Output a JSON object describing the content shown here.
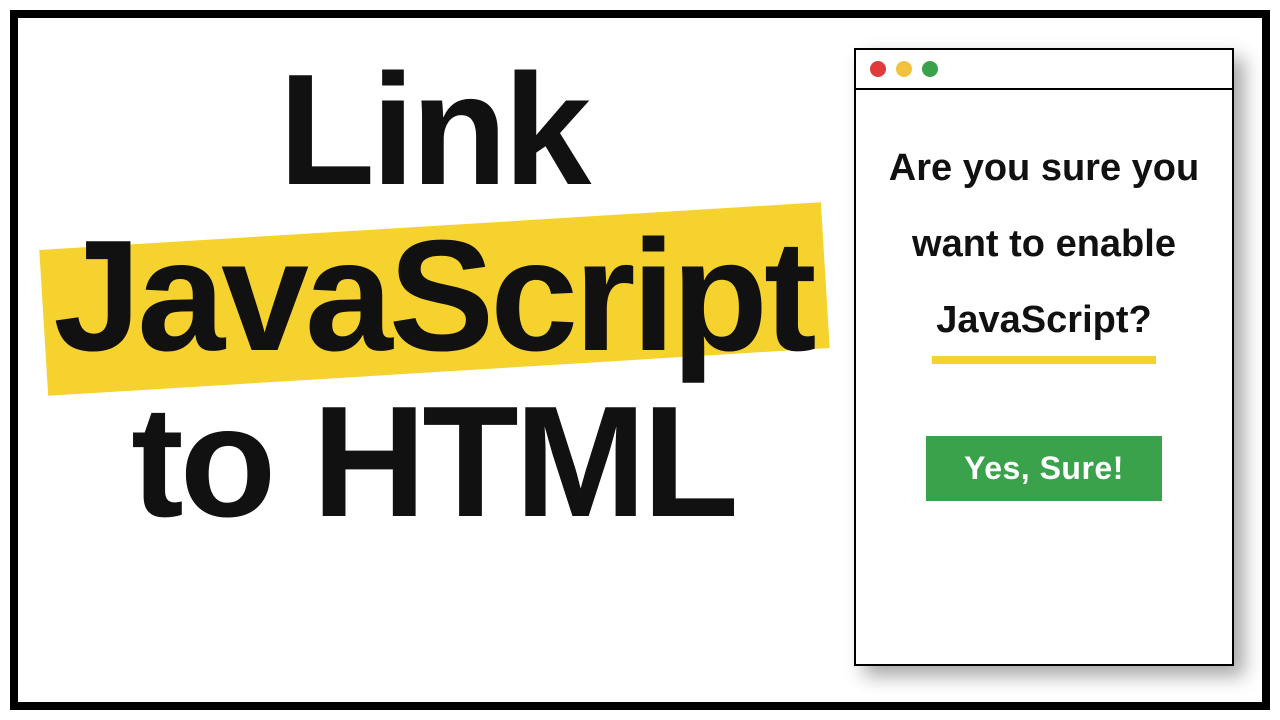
{
  "headline": {
    "line1": "Link",
    "line2": "JavaScript",
    "line3": "to HTML"
  },
  "dialog": {
    "question_part1": "Are you sure you",
    "question_part2": "want to enable",
    "question_part3": "JavaScript?",
    "button_label": "Yes, Sure!"
  },
  "colors": {
    "highlight": "#f6d22f",
    "button_bg": "#3aa24a",
    "traffic_red": "#e03a3a",
    "traffic_yellow": "#f2c23c",
    "traffic_green": "#3aa24a"
  }
}
